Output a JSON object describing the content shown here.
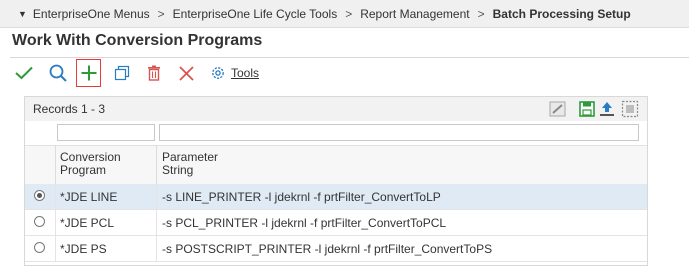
{
  "breadcrumb": {
    "items": [
      "EnterpriseOne Menus",
      "EnterpriseOne Life Cycle Tools",
      "Report Management",
      "Batch Processing Setup"
    ],
    "separator": ">"
  },
  "form": {
    "title": "Work With Conversion Programs"
  },
  "toolbar": {
    "ok_icon": "checkmark-icon",
    "find_icon": "search-icon",
    "add_icon": "plus-icon",
    "copy_icon": "copy-icon",
    "delete_icon": "trash-icon",
    "close_icon": "close-x-icon",
    "tools_icon": "gear-icon",
    "tools_label": "Tools"
  },
  "grid": {
    "records_label": "Records 1 - 3",
    "columns": [
      "Conversion\nProgram",
      "Parameter\nString"
    ],
    "rows": [
      {
        "program": "*JDE LINE",
        "parameter": "-s LINE_PRINTER -l jdekrnl -f prtFilter_ConvertToLP",
        "selected": true
      },
      {
        "program": "*JDE PCL",
        "parameter": "-s PCL_PRINTER -l jdekrnl -f prtFilter_ConvertToPCL",
        "selected": false
      },
      {
        "program": "*JDE PS",
        "parameter": "-s POSTSCRIPT_PRINTER -l jdekrnl -f prtFilter_ConvertToPS",
        "selected": false
      }
    ]
  },
  "colors": {
    "accent_green": "#2e9a3a",
    "accent_blue": "#2b7bc0",
    "delete_red": "#d9534f",
    "selected_row": "#dfeaf5"
  }
}
